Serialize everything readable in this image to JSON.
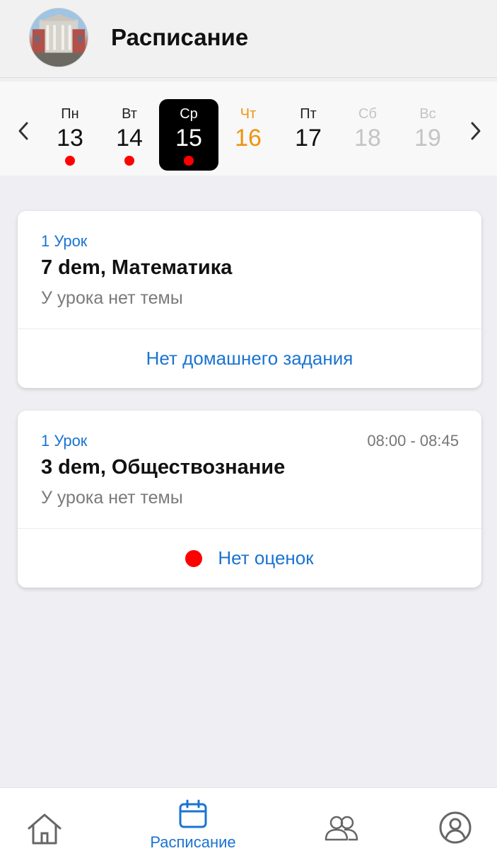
{
  "header": {
    "title": "Расписание",
    "avatar_icon": "school-building-avatar"
  },
  "week": {
    "prev_icon": "chevron-left-icon",
    "next_icon": "chevron-right-icon",
    "days": [
      {
        "name": "Пн",
        "num": "13",
        "has_dot": true,
        "state": "normal"
      },
      {
        "name": "Вт",
        "num": "14",
        "has_dot": true,
        "state": "normal"
      },
      {
        "name": "Ср",
        "num": "15",
        "has_dot": true,
        "state": "active"
      },
      {
        "name": "Чт",
        "num": "16",
        "has_dot": false,
        "state": "today"
      },
      {
        "name": "Пт",
        "num": "17",
        "has_dot": false,
        "state": "normal"
      },
      {
        "name": "Сб",
        "num": "18",
        "has_dot": false,
        "state": "weekend"
      },
      {
        "name": "Вс",
        "num": "19",
        "has_dot": false,
        "state": "weekend"
      }
    ]
  },
  "lessons": [
    {
      "number": "1 Урок",
      "time": "",
      "subject": "7 dem, Математика",
      "topic": "У урока нет темы",
      "footer": "Нет домашнего задания",
      "footer_dot": false
    },
    {
      "number": "1 Урок",
      "time": "08:00 - 08:45",
      "subject": "3 dem, Обществознание",
      "topic": "У урока нет темы",
      "footer": "Нет оценок",
      "footer_dot": true
    }
  ],
  "bottom_nav": {
    "items": [
      {
        "icon": "home-icon",
        "label": ""
      },
      {
        "icon": "calendar-icon",
        "label": "Расписание",
        "active": true
      },
      {
        "icon": "people-icon",
        "label": ""
      },
      {
        "icon": "profile-icon",
        "label": ""
      }
    ]
  },
  "colors": {
    "accent": "#1a73d1",
    "today": "#f0930e",
    "dot": "#ff0000",
    "background": "#eeeef3"
  }
}
